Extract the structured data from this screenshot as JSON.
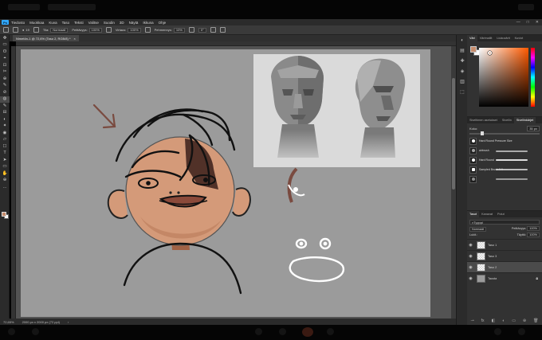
{
  "menu": {
    "items": [
      "Tiedosto",
      "Muokkaa",
      "Kuva",
      "Taso",
      "Teksti",
      "Valitse",
      "Suodin",
      "3D",
      "Näytä",
      "Ikkuna",
      "Ohje"
    ],
    "window_controls": [
      "—",
      "□",
      "✕"
    ]
  },
  "options_bar": {
    "tool_size": "19",
    "mode_label": "Tila:",
    "mode_value": "Normaali",
    "opacity_label": "Peittävyys:",
    "opacity_value": "100%",
    "flow_label": "Virtaus:",
    "flow_value": "100%",
    "smoothing_label": "Pehmennys:",
    "smoothing_value": "10%",
    "angle_value": "0°"
  },
  "document": {
    "tab_title": "Nimetön-1 @ 72,6% (Taso 2, RGB/8) *",
    "tab_close": "×"
  },
  "status": {
    "zoom": "72,65%",
    "doc_size": "2000 px x 2000 px (72 ppi)"
  },
  "tools": [
    "✥",
    "▭",
    "ʘ",
    "⌖",
    "⊡",
    "✂",
    "⊕",
    "✎",
    "⊘",
    "◍",
    "✎",
    "⊟",
    "◐",
    "✦",
    "◉",
    "▱",
    "☐",
    "T",
    "➤",
    "▭",
    "✋",
    "⊕",
    "…"
  ],
  "right_column_icons": [
    "◐",
    "▤",
    "✚",
    "◈",
    "▥",
    "⬚"
  ],
  "color_panel": {
    "tabs": [
      "Väri",
      "Värimallit",
      "Liukuvärit",
      "Kuviot"
    ],
    "foreground": "#c58b6b",
    "background": "#ffffff"
  },
  "brush_panel": {
    "tabs": [
      "Siveltimen asetukset",
      "Sivellin",
      "Sivellinkärjet"
    ],
    "size_label": "Koko:",
    "size_value": "35 px",
    "brushes": [
      {
        "name": "Hard Round Pressure Size"
      },
      {
        "name": "airbrush"
      },
      {
        "name": "Hard Round"
      },
      {
        "name": "Sampled Brush 3 9"
      },
      {
        "name": ""
      }
    ]
  },
  "layers_panel": {
    "tabs": [
      "Tasot",
      "Kanavat",
      "Polut"
    ],
    "search_placeholder": "Tyyppi",
    "blend_mode": "Normaali",
    "opacity_label": "Peittävyys:",
    "opacity_value": "100%",
    "lock_label": "Lukit.:",
    "fill_label": "Täyttö:",
    "fill_value": "100%",
    "layers": [
      {
        "name": "Taso 1",
        "visible": true,
        "selected": false,
        "type": "transparent"
      },
      {
        "name": "Taso 3",
        "visible": true,
        "selected": false,
        "type": "transparent"
      },
      {
        "name": "Taso 2",
        "visible": true,
        "selected": true,
        "type": "transparent"
      },
      {
        "name": "Tausta",
        "visible": true,
        "selected": false,
        "type": "background",
        "locked": true
      }
    ],
    "footer_icons": [
      "⊸",
      "fx",
      "◧",
      "◐",
      "▭",
      "⊕",
      "🗑"
    ]
  },
  "colors": {
    "ui_dark": "#2b2b2b",
    "canvas_bg": "#9b9b9b",
    "skin": "#d49a79",
    "skin_shadow": "#a06245",
    "hair_shade": "#3a1f1a",
    "brand_ps": "#31a8ff"
  }
}
